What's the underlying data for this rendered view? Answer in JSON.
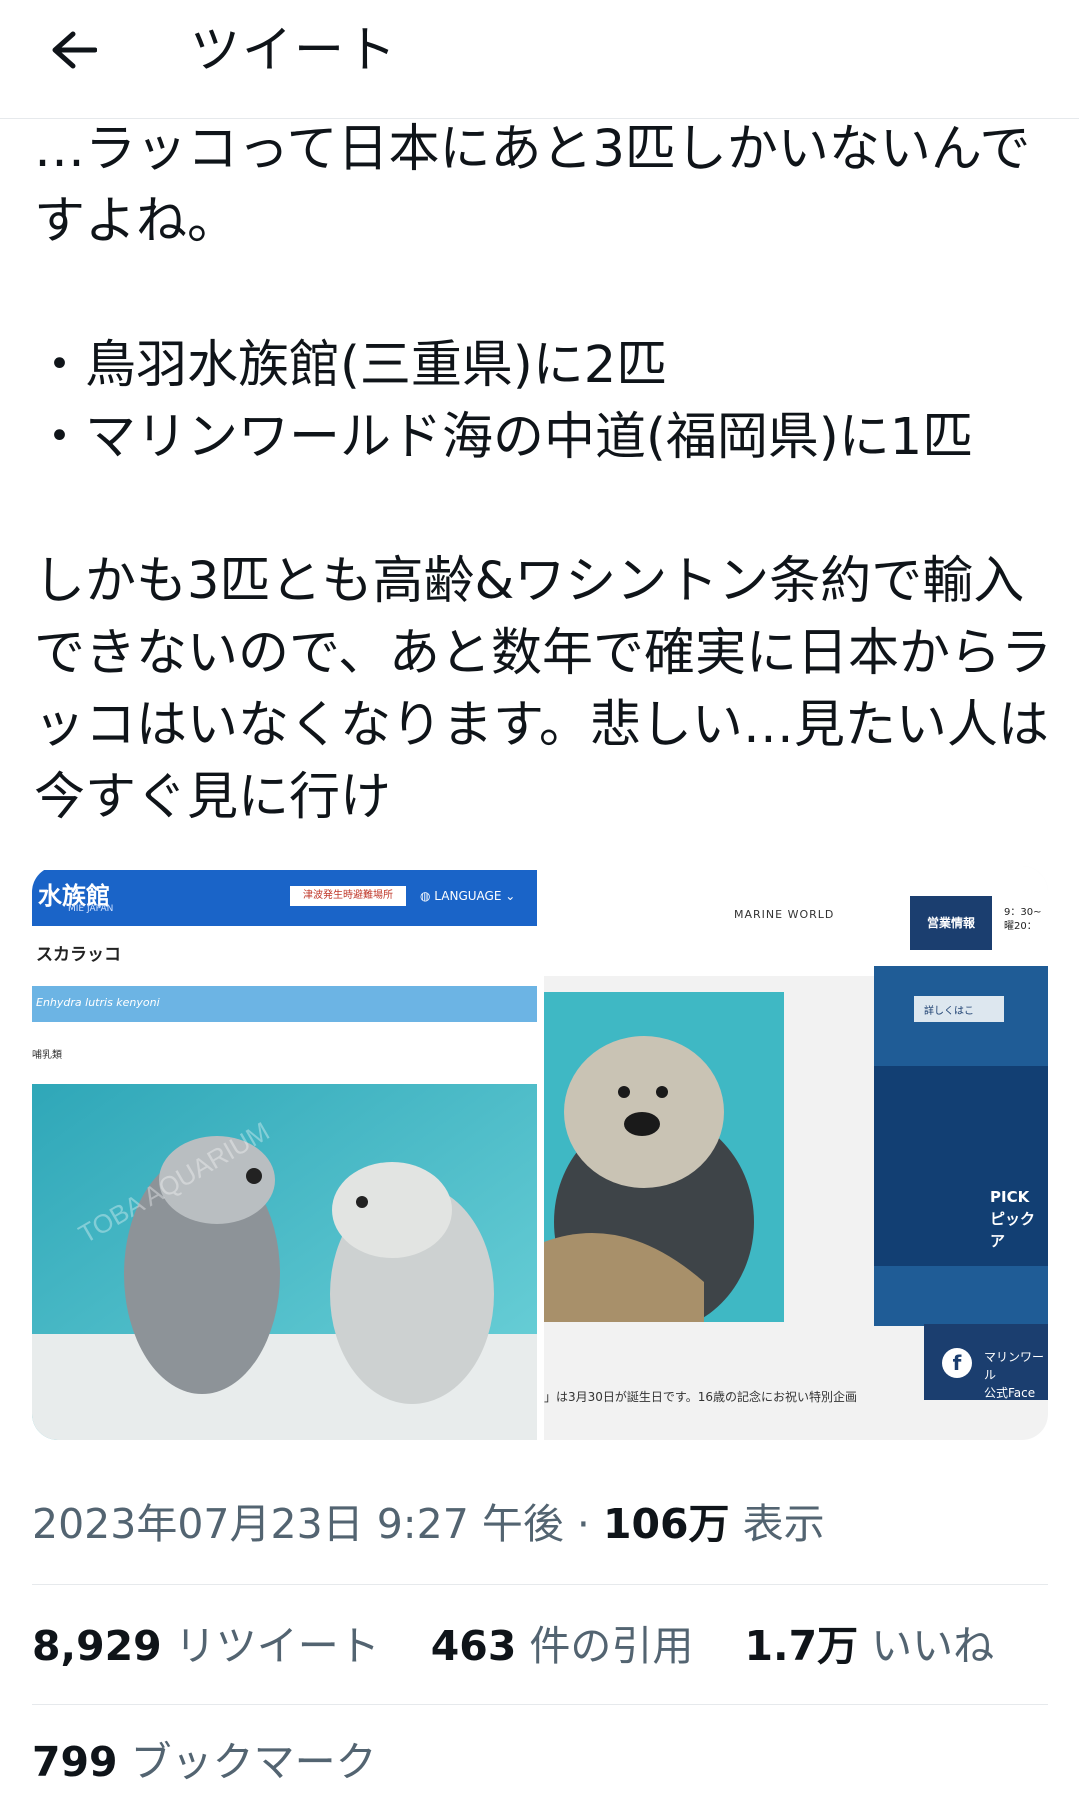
{
  "header": {
    "title": "ツイート",
    "back_icon": "arrow-left-icon"
  },
  "tweet": {
    "text": "…ラッコって日本にあと3匹しかいないんですよね。\n\n・鳥羽水族館(三重県)に2匹\n・マリンワールド海の中道(福岡県)に1匹\n\nしかも3匹とも高齢&ワシントン条約で輸入できないので、あと数年で確実に日本からラッコはいなくなります。悲しい…見たい人は今すぐ見に行け"
  },
  "media": {
    "left": {
      "logo": "水族館",
      "logo_sub": "MIE JAPAN",
      "notice": "津波発生時避難場所",
      "language": "LANGUAGE",
      "subtitle": "スカラッコ",
      "strip": "Enhydra lutris kenyoni",
      "note": "哺乳類",
      "watermark": "TOBA AQUARIUM"
    },
    "right": {
      "logo": "MARINE WORLD",
      "hours_label": "営業情報",
      "times": "9：30~\n曜20：",
      "caption": "」は3月30日が誕生日です。16歳の記念にお祝い特別企画",
      "pick": "PICK\nピックア",
      "fb_text": "マリンワール\n公式Face",
      "fb_icon": "facebook-icon",
      "detail_btn": "詳しくはこ"
    }
  },
  "meta": {
    "datetime": "2023年07月23日 9:27 午後",
    "separator": "·",
    "views_count": "106万",
    "views_label": "表示"
  },
  "stats": {
    "retweets_count": "8,929",
    "retweets_label": "リツイート",
    "quotes_count": "463",
    "quotes_label": "件の引用",
    "likes_count": "1.7万",
    "likes_label": "いいね"
  },
  "bookmarks": {
    "count": "799",
    "label": "ブックマーク"
  },
  "colors": {
    "text": "#0f1419",
    "secondary": "#536471",
    "divider": "#e6e9ec",
    "toba_blue": "#1a64c8",
    "marine_navy": "#1b3e6f",
    "water": "#3fb8c4"
  }
}
